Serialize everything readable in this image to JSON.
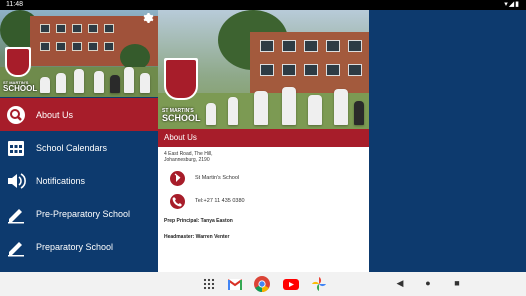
{
  "status_bar": {
    "time": "11:48",
    "icons": "▾◢▮"
  },
  "drawer": {
    "school_name_small": "ST MARTIN'S",
    "school_name": "SCHOOL",
    "items": [
      {
        "label": "About Us",
        "icon": "search-icon"
      },
      {
        "label": "School Calendars",
        "icon": "calendar-icon"
      },
      {
        "label": "Notifications",
        "icon": "speaker-icon"
      },
      {
        "label": "Pre-Preparatory School",
        "icon": "pencil-icon"
      },
      {
        "label": "Preparatory School",
        "icon": "pencil-icon"
      }
    ]
  },
  "content": {
    "school_name_small": "ST MARTIN'S",
    "school_name": "SCHOOL",
    "section_title": "About Us",
    "address_line1": "4 East Road, The Hill,",
    "address_line2": "Johannesburg, 2190",
    "contacts": [
      {
        "icon": "link-icon",
        "text": "St Martin's School"
      },
      {
        "icon": "phone-icon",
        "text": "Tel:+27 11 435 0380"
      }
    ],
    "prep_principal": "Prep Principal: Tanya Easton",
    "headmaster": "Headmaster: Warren Venter"
  },
  "navbar": {
    "dock": [
      "apps-grid-icon",
      "gmail-icon",
      "chrome-icon",
      "youtube-icon",
      "photos-icon"
    ],
    "back": "◀",
    "home": "●",
    "recents": "■"
  },
  "colors": {
    "navy": "#0d3a6e",
    "crimson": "#a71d2a"
  }
}
